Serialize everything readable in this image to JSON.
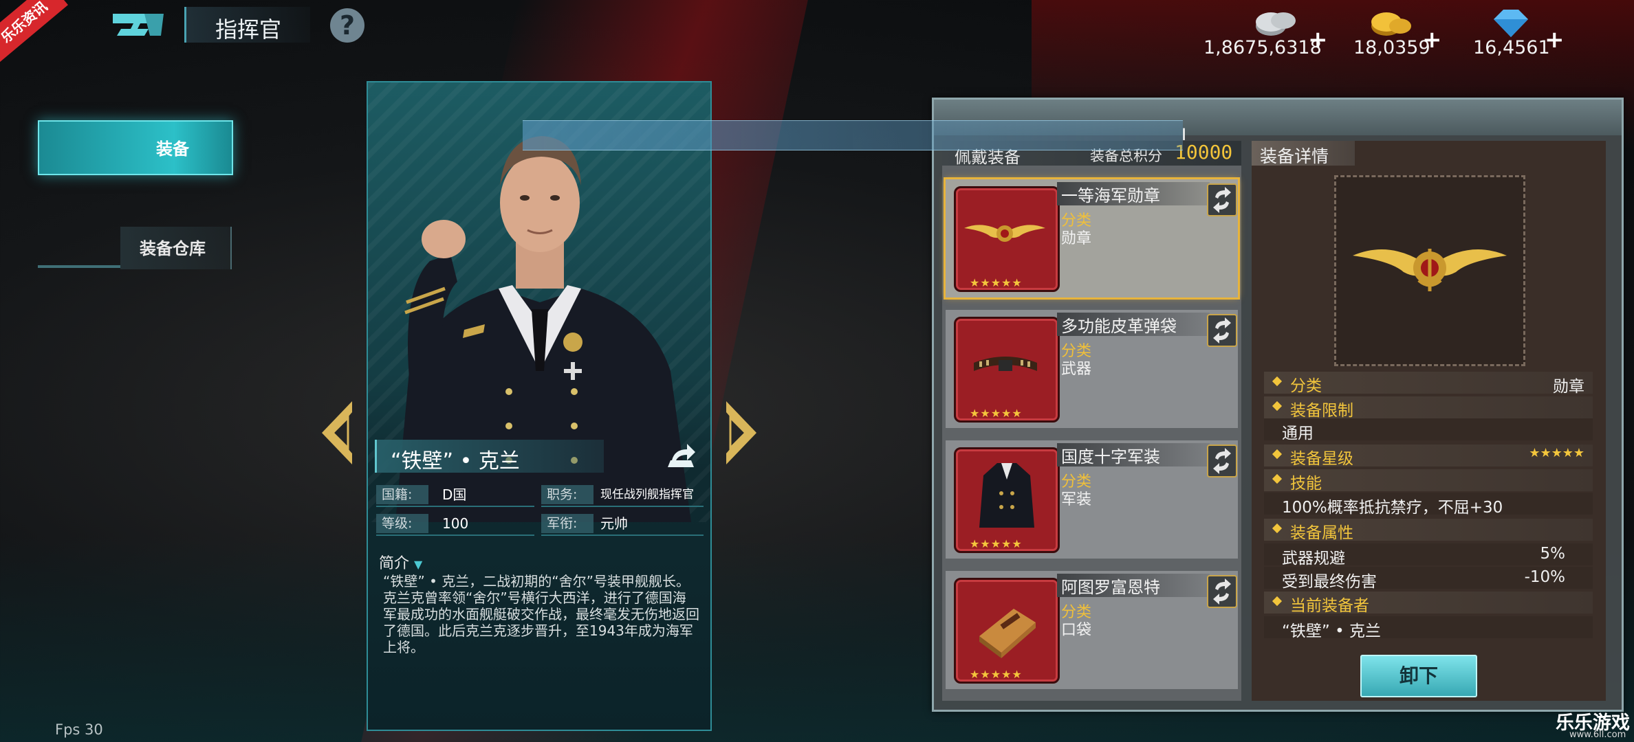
{
  "corner_badge": "乐乐资讯",
  "header": {
    "title": "指挥官",
    "help_icon": "question-icon"
  },
  "currencies": [
    {
      "icon": "silver-coin-icon",
      "value": "1,8675,6318",
      "plus": "+"
    },
    {
      "icon": "gold-coin-icon",
      "value": "18,0359",
      "plus": "+"
    },
    {
      "icon": "diamond-icon",
      "value": "16,4561",
      "plus": "+"
    }
  ],
  "tabs": {
    "equipment": "装备",
    "warehouse": "装备仓库"
  },
  "commander": {
    "name": "“铁壁” • 克兰",
    "nationality_label": "国籍:",
    "nationality": "D国",
    "position_label": "职务:",
    "position": "现任战列舰指挥官",
    "level_label": "等级:",
    "level": "100",
    "rank_label": "军衔:",
    "rank": "元帅",
    "intro_title": "简介",
    "intro_text": "“铁壁” • 克兰，二战初期的“舍尔”号装甲舰舰长。克兰克曾率领“舍尔”号横行大西洋，进行了德国海军最成功的水面舰艇破交作战，最终毫发无伤地返回了德国。此后克兰克逐步晋升，至1943年成为海军上将。"
  },
  "worn": {
    "title": "佩戴装备",
    "score_label": "装备总积分",
    "score": "10000",
    "items": [
      {
        "name": "一等海军勋章",
        "cat_label": "分类",
        "category": "勋章",
        "stars": "★★★★★",
        "selected": true
      },
      {
        "name": "多功能皮革弹袋",
        "cat_label": "分类",
        "category": "武器",
        "stars": "★★★★★",
        "selected": false
      },
      {
        "name": "国度十字军装",
        "cat_label": "分类",
        "category": "军装",
        "stars": "★★★★★",
        "selected": false
      },
      {
        "name": "阿图罗富恩特",
        "cat_label": "分类",
        "category": "口袋",
        "stars": "★★★★★",
        "selected": false
      }
    ]
  },
  "detail": {
    "title": "装备详情",
    "category_label": "分类",
    "category": "勋章",
    "limit_label": "装备限制",
    "limit": "通用",
    "star_label": "装备星级",
    "stars": "★★★★★",
    "skill_label": "技能",
    "skill": "100%概率抵抗禁疗，不屈+30",
    "attr_label": "装备属性",
    "attrs": [
      {
        "name": "武器规避",
        "value": "5%"
      },
      {
        "name": "受到最终伤害",
        "value": "-10%"
      }
    ],
    "owner_label": "当前装备者",
    "owner": "“铁壁” • 克兰",
    "unequip": "卸下"
  },
  "fps": "Fps 30",
  "watermark": {
    "brand": "乐乐游戏",
    "url": "www.6ll.com"
  }
}
